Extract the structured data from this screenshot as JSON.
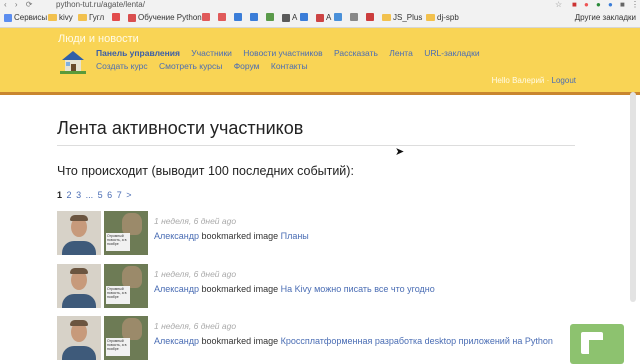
{
  "browser": {
    "url": "python-tut.ru/agate/lenta/",
    "bookmarks": [
      {
        "label": "Сервисы",
        "color": "#5b8def",
        "type": "app"
      },
      {
        "label": "kivy",
        "color": "#f2c14e",
        "type": "folder"
      },
      {
        "label": "Гугл",
        "color": "#f2c14e",
        "type": "folder"
      },
      {
        "label": "",
        "color": "#e24c4c",
        "type": "site"
      },
      {
        "label": "Обучение Python 3",
        "color": "#d94f4f",
        "type": "site"
      },
      {
        "label": "",
        "color": "#e05a5a",
        "type": "site"
      },
      {
        "label": "",
        "color": "#e05a5a",
        "type": "site"
      },
      {
        "label": "",
        "color": "#3b7dd8",
        "type": "site"
      },
      {
        "label": "",
        "color": "#3b7dd8",
        "type": "site"
      },
      {
        "label": "",
        "color": "#5a9a4a",
        "type": "site"
      },
      {
        "label": "А",
        "color": "#5a5a5a",
        "type": "site"
      },
      {
        "label": "",
        "color": "#3b7dd8",
        "type": "site"
      },
      {
        "label": "А",
        "color": "#c44",
        "type": "site"
      },
      {
        "label": "",
        "color": "#4a90d9",
        "type": "site"
      },
      {
        "label": "",
        "color": "#888",
        "type": "site"
      },
      {
        "label": "",
        "color": "#cc3d3d",
        "type": "site"
      },
      {
        "label": "JS_Plus",
        "color": "#f2c14e",
        "type": "folder"
      },
      {
        "label": "dj-spb",
        "color": "#f2c14e",
        "type": "folder"
      }
    ],
    "other_bookmarks": "Другие закладки"
  },
  "site": {
    "brand": "Люди и новости",
    "nav": [
      "Панель управления",
      "Участники",
      "Новости участников",
      "Рассказать",
      "Лента",
      "URL-закладки",
      "Создать курс",
      "Смотреть курсы",
      "Форум",
      "Контакты"
    ],
    "user_greeting": "Hello Валерий",
    "logout": "Logout"
  },
  "main": {
    "title": "Лента активности участников",
    "subtitle": "Что происходит (выводит 100 последних событий):",
    "pagination": [
      "1",
      "2",
      "3",
      "...",
      "5",
      "6",
      "7",
      ">"
    ],
    "feed": [
      {
        "time": "1 неделя, 6 дней ago",
        "user": "Александр",
        "action": "bookmarked image",
        "target": "Планы",
        "thumb_text": "Огромный новость, а в ноябре"
      },
      {
        "time": "1 неделя, 6 дней ago",
        "user": "Александр",
        "action": "bookmarked image",
        "target": "На Kivy можно писать все что угодно",
        "thumb_text": "Огромный новость, а в ноябре"
      },
      {
        "time": "1 неделя, 6 дней ago",
        "user": "Александр",
        "action": "bookmarked image",
        "target": "Кроссплатформенная разработка desktop приложений на Python",
        "thumb_text": "Огромный новость, а в ноябре"
      }
    ]
  }
}
